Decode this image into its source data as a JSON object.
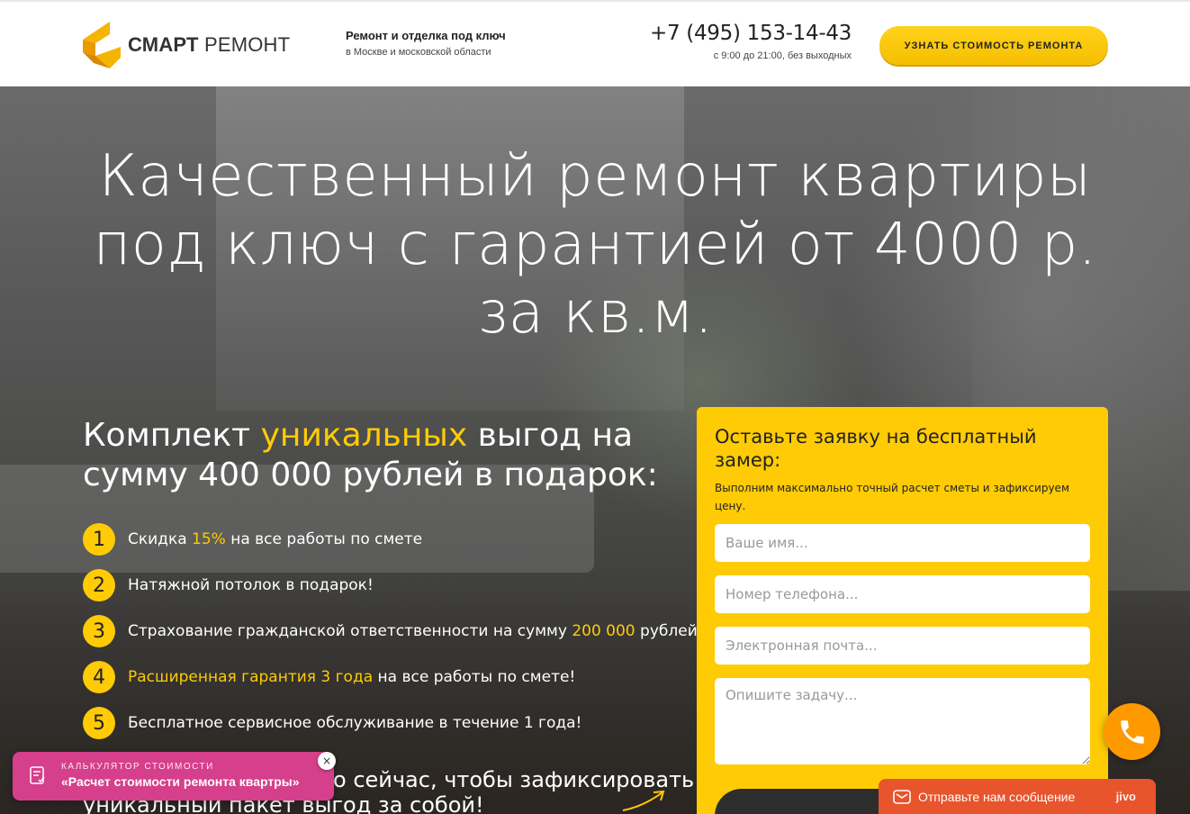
{
  "header": {
    "logo_bold": "СМАРТ",
    "logo_regular": "РЕМОНТ",
    "tagline_title": "Ремонт и отделка под ключ",
    "tagline_sub": "в Москве и московской области",
    "phone": "+7 (495) 153-14-43",
    "hours": "с 9:00 до 21:00, без выходных",
    "cta_label": "УЗНАТЬ СТОИМОСТЬ РЕМОНТА"
  },
  "hero": {
    "title_line1": "Качественный ремонт квартиры",
    "title_line2": "под ключ с гарантией от 4000 р.",
    "title_line3": "за кв.м.",
    "subtitle_part1": "Комплект ",
    "subtitle_highlight": "уникальных",
    "subtitle_part2": " выгод на сумму 400 000 рублей в подарок:",
    "benefits": [
      {
        "num": "1",
        "pre": "Скидка ",
        "hl": "15%",
        "post": " на все работы по смете"
      },
      {
        "num": "2",
        "pre": "Натяжной потолок в подарок!",
        "hl": "",
        "post": ""
      },
      {
        "num": "3",
        "pre": "Страхование гражданской ответственности на сумму ",
        "hl": "200 000",
        "post": " рублей"
      },
      {
        "num": "4",
        "pre": "",
        "hl": "Расширенная гарантия 3 года",
        "post": " на все работы по смете!"
      },
      {
        "num": "5",
        "pre": "Бесплатное сервисное обслуживание в течение 1 года!",
        "hl": "",
        "post": ""
      }
    ],
    "bottom_line1": "о сейчас, чтобы зафиксировать",
    "bottom_line2": "уникальный пакет выгод за собой!"
  },
  "form": {
    "title": "Оставьте заявку на бесплатный замер:",
    "subtitle": "Выполним максимально точный расчет сметы и зафиксируем цену.",
    "name_placeholder": "Ваше имя...",
    "phone_placeholder": "Номер телефона...",
    "email_placeholder": "Электронная почта...",
    "task_placeholder": "Опишите задачу..."
  },
  "calculator": {
    "label": "КАЛЬКУЛЯТОР СТОИМОСТИ",
    "title": "«Расчет стоимости ремонта квартры»",
    "close": "×"
  },
  "chat": {
    "text": "Отправьте нам сообщение",
    "brand": "jivo"
  },
  "colors": {
    "accent": "#ffcb05",
    "calc_bg": "#d63f8b",
    "call_bg": "#ff9900",
    "chat_bg": "#e8542b"
  },
  "icons": [
    "logo-icon",
    "arrow-icon",
    "calculator-icon",
    "phone-icon",
    "envelope-icon"
  ]
}
